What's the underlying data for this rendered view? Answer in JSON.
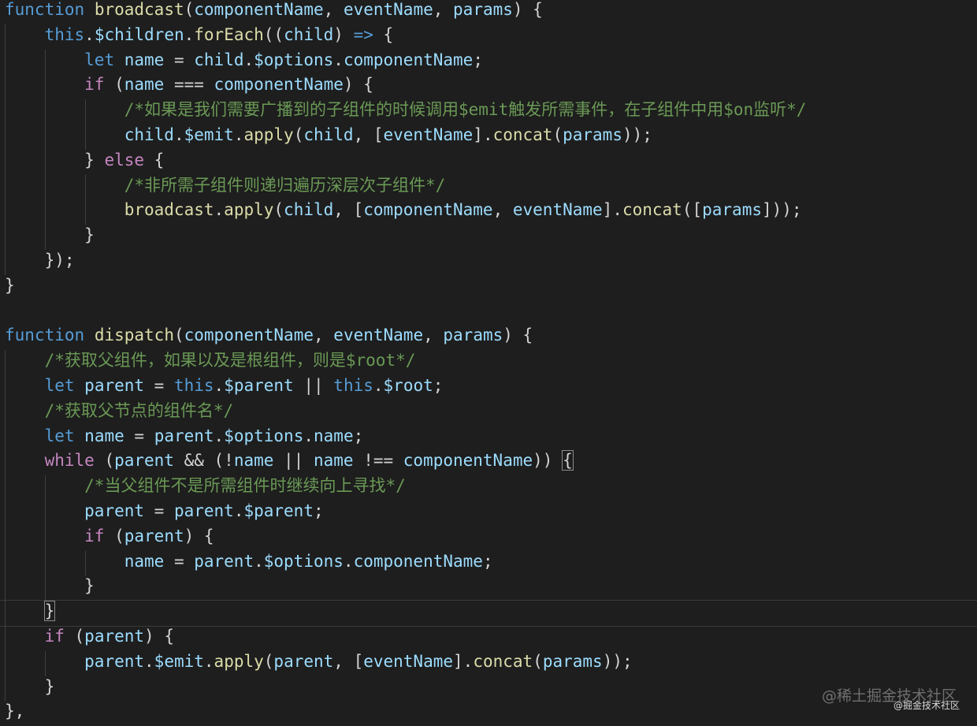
{
  "colors": {
    "background": "#1e1e1e",
    "keyword": "#569cd6",
    "control": "#c586c0",
    "function": "#dcdcaa",
    "variable": "#9cdcfe",
    "comment": "#6a9955",
    "text": "#d4d4d4"
  },
  "lines": [
    [
      [
        "kw",
        "function"
      ],
      [
        "p",
        " "
      ],
      [
        "fn",
        "broadcast"
      ],
      [
        "p",
        "("
      ],
      [
        "v",
        "componentName"
      ],
      [
        "p",
        ", "
      ],
      [
        "v",
        "eventName"
      ],
      [
        "p",
        ", "
      ],
      [
        "v",
        "params"
      ],
      [
        "p",
        ") {"
      ]
    ],
    [
      [
        "p",
        "    "
      ],
      [
        "kw",
        "this"
      ],
      [
        "p",
        "."
      ],
      [
        "v",
        "$children"
      ],
      [
        "p",
        "."
      ],
      [
        "fn",
        "forEach"
      ],
      [
        "p",
        "(("
      ],
      [
        "v",
        "child"
      ],
      [
        "p",
        ") "
      ],
      [
        "kw",
        "=>"
      ],
      [
        "p",
        " {"
      ]
    ],
    [
      [
        "p",
        "        "
      ],
      [
        "kw",
        "let"
      ],
      [
        "p",
        " "
      ],
      [
        "v",
        "name"
      ],
      [
        "p",
        " = "
      ],
      [
        "v",
        "child"
      ],
      [
        "p",
        "."
      ],
      [
        "v",
        "$options"
      ],
      [
        "p",
        "."
      ],
      [
        "v",
        "componentName"
      ],
      [
        "p",
        ";"
      ]
    ],
    [
      [
        "p",
        "        "
      ],
      [
        "ct",
        "if"
      ],
      [
        "p",
        " ("
      ],
      [
        "v",
        "name"
      ],
      [
        "p",
        " === "
      ],
      [
        "v",
        "componentName"
      ],
      [
        "p",
        ") {"
      ]
    ],
    [
      [
        "p",
        "            "
      ],
      [
        "cm",
        "/*如果是我们需要广播到的子组件的时候调用$emit触发所需事件，在子组件中用$on监听*/"
      ]
    ],
    [
      [
        "p",
        "            "
      ],
      [
        "v",
        "child"
      ],
      [
        "p",
        "."
      ],
      [
        "v",
        "$emit"
      ],
      [
        "p",
        "."
      ],
      [
        "fn",
        "apply"
      ],
      [
        "p",
        "("
      ],
      [
        "v",
        "child"
      ],
      [
        "p",
        ", ["
      ],
      [
        "v",
        "eventName"
      ],
      [
        "p",
        "]."
      ],
      [
        "fn",
        "concat"
      ],
      [
        "p",
        "("
      ],
      [
        "v",
        "params"
      ],
      [
        "p",
        "));"
      ]
    ],
    [
      [
        "p",
        "        } "
      ],
      [
        "ct",
        "else"
      ],
      [
        "p",
        " {"
      ]
    ],
    [
      [
        "p",
        "            "
      ],
      [
        "cm",
        "/*非所需子组件则递归遍历深层次子组件*/"
      ]
    ],
    [
      [
        "p",
        "            "
      ],
      [
        "fn",
        "broadcast"
      ],
      [
        "p",
        "."
      ],
      [
        "fn",
        "apply"
      ],
      [
        "p",
        "("
      ],
      [
        "v",
        "child"
      ],
      [
        "p",
        ", ["
      ],
      [
        "v",
        "componentName"
      ],
      [
        "p",
        ", "
      ],
      [
        "v",
        "eventName"
      ],
      [
        "p",
        "]."
      ],
      [
        "fn",
        "concat"
      ],
      [
        "p",
        "(["
      ],
      [
        "v",
        "params"
      ],
      [
        "p",
        "]));"
      ]
    ],
    [
      [
        "p",
        "        }"
      ]
    ],
    [
      [
        "p",
        "    });"
      ]
    ],
    [
      [
        "p",
        "}"
      ]
    ],
    [
      [
        "p",
        ""
      ]
    ],
    [
      [
        "kw",
        "function"
      ],
      [
        "p",
        " "
      ],
      [
        "fn",
        "dispatch"
      ],
      [
        "p",
        "("
      ],
      [
        "v",
        "componentName"
      ],
      [
        "p",
        ", "
      ],
      [
        "v",
        "eventName"
      ],
      [
        "p",
        ", "
      ],
      [
        "v",
        "params"
      ],
      [
        "p",
        ") {"
      ]
    ],
    [
      [
        "p",
        "    "
      ],
      [
        "cm",
        "/*获取父组件，如果以及是根组件，则是$root*/"
      ]
    ],
    [
      [
        "p",
        "    "
      ],
      [
        "kw",
        "let"
      ],
      [
        "p",
        " "
      ],
      [
        "v",
        "parent"
      ],
      [
        "p",
        " = "
      ],
      [
        "kw",
        "this"
      ],
      [
        "p",
        "."
      ],
      [
        "v",
        "$parent"
      ],
      [
        "p",
        " || "
      ],
      [
        "kw",
        "this"
      ],
      [
        "p",
        "."
      ],
      [
        "v",
        "$root"
      ],
      [
        "p",
        ";"
      ]
    ],
    [
      [
        "p",
        "    "
      ],
      [
        "cm",
        "/*获取父节点的组件名*/"
      ]
    ],
    [
      [
        "p",
        "    "
      ],
      [
        "kw",
        "let"
      ],
      [
        "p",
        " "
      ],
      [
        "v",
        "name"
      ],
      [
        "p",
        " = "
      ],
      [
        "v",
        "parent"
      ],
      [
        "p",
        "."
      ],
      [
        "v",
        "$options"
      ],
      [
        "p",
        "."
      ],
      [
        "v",
        "name"
      ],
      [
        "p",
        ";"
      ]
    ],
    [
      [
        "p",
        "    "
      ],
      [
        "ct",
        "while"
      ],
      [
        "p",
        " ("
      ],
      [
        "v",
        "parent"
      ],
      [
        "p",
        " && (!"
      ],
      [
        "v",
        "name"
      ],
      [
        "p",
        " || "
      ],
      [
        "v",
        "name"
      ],
      [
        "p",
        " !== "
      ],
      [
        "v",
        "componentName"
      ],
      [
        "p",
        ")) "
      ],
      [
        "pm",
        "{"
      ]
    ],
    [
      [
        "p",
        "        "
      ],
      [
        "cm",
        "/*当父组件不是所需组件时继续向上寻找*/"
      ]
    ],
    [
      [
        "p",
        "        "
      ],
      [
        "v",
        "parent"
      ],
      [
        "p",
        " = "
      ],
      [
        "v",
        "parent"
      ],
      [
        "p",
        "."
      ],
      [
        "v",
        "$parent"
      ],
      [
        "p",
        ";"
      ]
    ],
    [
      [
        "p",
        "        "
      ],
      [
        "ct",
        "if"
      ],
      [
        "p",
        " ("
      ],
      [
        "v",
        "parent"
      ],
      [
        "p",
        ") {"
      ]
    ],
    [
      [
        "p",
        "            "
      ],
      [
        "v",
        "name"
      ],
      [
        "p",
        " = "
      ],
      [
        "v",
        "parent"
      ],
      [
        "p",
        "."
      ],
      [
        "v",
        "$options"
      ],
      [
        "p",
        "."
      ],
      [
        "v",
        "componentName"
      ],
      [
        "p",
        ";"
      ]
    ],
    [
      [
        "p",
        "        }"
      ]
    ],
    [
      [
        "p",
        "    "
      ],
      [
        "pm",
        "}"
      ]
    ],
    [
      [
        "p",
        "    "
      ],
      [
        "ct",
        "if"
      ],
      [
        "p",
        " ("
      ],
      [
        "v",
        "parent"
      ],
      [
        "p",
        ") {"
      ]
    ],
    [
      [
        "p",
        "        "
      ],
      [
        "v",
        "parent"
      ],
      [
        "p",
        "."
      ],
      [
        "v",
        "$emit"
      ],
      [
        "p",
        "."
      ],
      [
        "fn",
        "apply"
      ],
      [
        "p",
        "("
      ],
      [
        "v",
        "parent"
      ],
      [
        "p",
        ", ["
      ],
      [
        "v",
        "eventName"
      ],
      [
        "p",
        "]."
      ],
      [
        "fn",
        "concat"
      ],
      [
        "p",
        "("
      ],
      [
        "v",
        "params"
      ],
      [
        "p",
        "));"
      ]
    ],
    [
      [
        "p",
        "    }"
      ]
    ],
    [
      [
        "p",
        "},"
      ]
    ]
  ],
  "watermark": "@稀土掘金技术社区",
  "watermark_small": "@掘金技术社区"
}
